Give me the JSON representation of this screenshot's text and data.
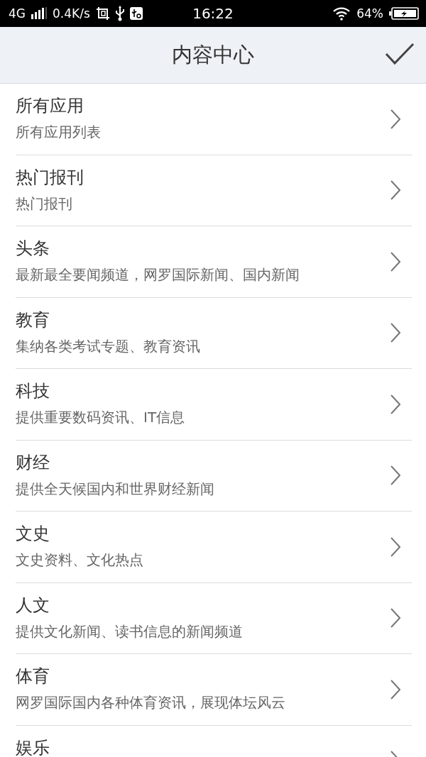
{
  "status_bar": {
    "network": "4G",
    "speed": "0.4K/s",
    "time": "16:22",
    "battery": "64%"
  },
  "header": {
    "title": "内容中心"
  },
  "items": [
    {
      "title": "所有应用",
      "subtitle": "所有应用列表"
    },
    {
      "title": "热门报刊",
      "subtitle": "热门报刊"
    },
    {
      "title": "头条",
      "subtitle": "最新最全要闻频道，网罗国际新闻、国内新闻"
    },
    {
      "title": "教育",
      "subtitle": "集纳各类考试专题、教育资讯"
    },
    {
      "title": "科技",
      "subtitle": "提供重要数码资讯、IT信息"
    },
    {
      "title": "财经",
      "subtitle": "提供全天候国内和世界财经新闻"
    },
    {
      "title": "文史",
      "subtitle": "文史资料、文化热点"
    },
    {
      "title": "人文",
      "subtitle": "提供文化新闻、读书信息的新闻频道"
    },
    {
      "title": "体育",
      "subtitle": "网罗国际国内各种体育资讯，展现体坛风云"
    },
    {
      "title": "娱乐"
    }
  ]
}
